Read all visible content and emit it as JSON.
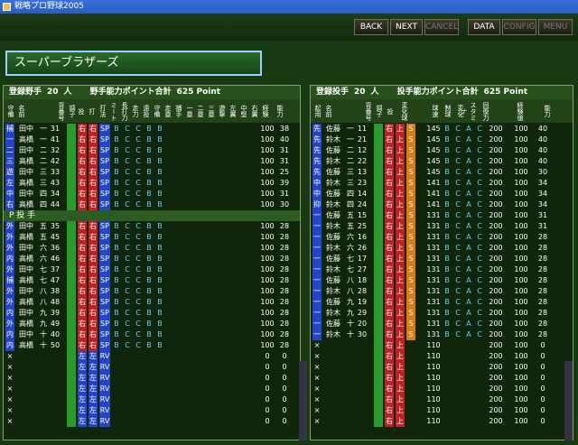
{
  "window": {
    "title": "戦略プロ野球2005"
  },
  "toolbar": {
    "back": "BACK",
    "next": "NEXT",
    "cancel": "CANCEL",
    "data": "DATA",
    "config": "CONFIG",
    "menu": "MENU"
  },
  "team": {
    "name": "スーパーブラザーズ"
  },
  "batters": {
    "count_label": "登録野手",
    "count": "20",
    "unit": "人",
    "points_label": "野手能力ポイント合計",
    "points": "625 Point",
    "headers": [
      "守備",
      "名前",
      "背番号",
      "調子",
      "投",
      "打",
      "打法",
      "ミート",
      "長打力",
      "走力",
      "遠投",
      "守備",
      "走塁",
      "捕手",
      "一塁",
      "二塁",
      "三塁",
      "遊撃",
      "左翼",
      "中堅",
      "右翼",
      "経験",
      "能力"
    ],
    "rows": [
      [
        "捕",
        "田中",
        "一",
        "31",
        "100",
        "38"
      ],
      [
        "一",
        "高橋",
        "一",
        "41",
        "100",
        "40"
      ],
      [
        "二",
        "田中",
        "二",
        "32",
        "100",
        "31"
      ],
      [
        "三",
        "高橋",
        "二",
        "42",
        "100",
        "31"
      ],
      [
        "遊",
        "田中",
        "三",
        "33",
        "100",
        "25"
      ],
      [
        "左",
        "高橋",
        "三",
        "43",
        "100",
        "39"
      ],
      [
        "中",
        "田中",
        "四",
        "34",
        "100",
        "31"
      ],
      [
        "右",
        "高橋",
        "四",
        "44",
        "100",
        "30"
      ]
    ],
    "pitcher_label": "P 投 手",
    "bench": [
      [
        "外",
        "田中",
        "五",
        "35",
        "100",
        "28"
      ],
      [
        "外",
        "高橋",
        "五",
        "45",
        "100",
        "28"
      ],
      [
        "外",
        "田中",
        "六",
        "36",
        "100",
        "28"
      ],
      [
        "内",
        "高橋",
        "六",
        "46",
        "100",
        "28"
      ],
      [
        "外",
        "田中",
        "七",
        "37",
        "100",
        "28"
      ],
      [
        "捕",
        "高橋",
        "七",
        "47",
        "100",
        "28"
      ],
      [
        "外",
        "田中",
        "八",
        "38",
        "100",
        "28"
      ],
      [
        "外",
        "高橋",
        "八",
        "48",
        "100",
        "28"
      ],
      [
        "内",
        "田中",
        "九",
        "39",
        "100",
        "28"
      ],
      [
        "外",
        "高橋",
        "九",
        "49",
        "100",
        "28"
      ],
      [
        "内",
        "田中",
        "十",
        "40",
        "100",
        "28"
      ],
      [
        "内",
        "高橋",
        "十",
        "50",
        "100",
        "28"
      ]
    ],
    "empty": [
      "×",
      "×",
      "×",
      "×",
      "×",
      "×",
      "×"
    ]
  },
  "pitchers": {
    "count_label": "登録投手",
    "count": "20",
    "unit": "人",
    "points_label": "投手能力ポイント合計",
    "points": "625 Point",
    "headers": [
      "起用",
      "名前",
      "背番号",
      "調子",
      "投",
      "変化球",
      "球速",
      "制球",
      "変化",
      "スタミナ",
      "回復力",
      "経験値",
      "能力"
    ],
    "rows": [
      [
        "先",
        "佐藤",
        "一",
        "11",
        "145",
        "200",
        "100",
        "40"
      ],
      [
        "先",
        "鈴木",
        "一",
        "21",
        "145",
        "200",
        "100",
        "40"
      ],
      [
        "先",
        "佐藤",
        "二",
        "12",
        "145",
        "200",
        "100",
        "40"
      ],
      [
        "先",
        "鈴木",
        "二",
        "22",
        "145",
        "200",
        "100",
        "40"
      ],
      [
        "先",
        "佐藤",
        "三",
        "13",
        "145",
        "200",
        "100",
        "30"
      ],
      [
        "中",
        "鈴木",
        "三",
        "23",
        "141",
        "200",
        "100",
        "34"
      ],
      [
        "中",
        "佐藤",
        "四",
        "14",
        "141",
        "200",
        "100",
        "34"
      ],
      [
        "抑",
        "鈴木",
        "四",
        "24",
        "141",
        "200",
        "100",
        "34"
      ],
      [
        "一",
        "佐藤",
        "五",
        "15",
        "131",
        "200",
        "100",
        "31"
      ],
      [
        "一",
        "鈴木",
        "五",
        "25",
        "131",
        "200",
        "100",
        "31"
      ],
      [
        "一",
        "佐藤",
        "六",
        "16",
        "131",
        "200",
        "100",
        "28"
      ],
      [
        "一",
        "鈴木",
        "六",
        "26",
        "131",
        "200",
        "100",
        "28"
      ],
      [
        "一",
        "佐藤",
        "七",
        "17",
        "131",
        "200",
        "100",
        "28"
      ],
      [
        "一",
        "鈴木",
        "七",
        "27",
        "131",
        "200",
        "100",
        "28"
      ],
      [
        "一",
        "佐藤",
        "八",
        "18",
        "131",
        "200",
        "100",
        "28"
      ],
      [
        "一",
        "鈴木",
        "八",
        "28",
        "131",
        "200",
        "100",
        "28"
      ],
      [
        "一",
        "佐藤",
        "九",
        "19",
        "131",
        "200",
        "100",
        "28"
      ],
      [
        "一",
        "鈴木",
        "九",
        "29",
        "131",
        "200",
        "100",
        "28"
      ],
      [
        "一",
        "佐藤",
        "十",
        "20",
        "131",
        "200",
        "100",
        "28"
      ],
      [
        "一",
        "鈴木",
        "十",
        "30",
        "131",
        "200",
        "100",
        "28"
      ]
    ],
    "empty_speed": "110",
    "empty_stamina": "200",
    "empty_exp": "100",
    "empty_rows": [
      "×",
      "×",
      "×",
      "×",
      "×",
      "×",
      "×",
      "×"
    ]
  }
}
